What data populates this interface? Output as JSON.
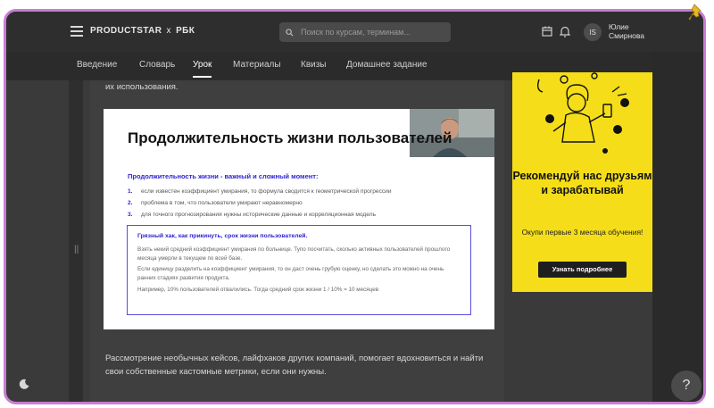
{
  "header": {
    "logo_text": "PRODUCTSTAR",
    "logo_x": "x",
    "logo_partner": "РБК",
    "search_placeholder": "Поиск по курсам, терминам...",
    "user_initials": "IS",
    "user_first": "Юлие",
    "user_last": "Смирнова"
  },
  "tabs": [
    "Введение",
    "Словарь",
    "Урок",
    "Материалы",
    "Квизы",
    "Домашнее задание"
  ],
  "active_tab": "Урок",
  "lesson": {
    "text_top": "их использования.",
    "text_bottom": "Рассмотрение необычных кейсов, лайфхаков других компаний, помогает вдохновиться и найти свои собственные кастомные метрики, если они нужны."
  },
  "slide": {
    "title": "Продолжительность жизни пользователей",
    "subheading": "Продолжительность жизни - важный и сложный момент:",
    "points": [
      {
        "n": "1.",
        "text": "если известен коэффициент умирания, то формула сводится к геометрической прогрессии"
      },
      {
        "n": "2.",
        "text": "проблема в том, что пользователи умирают неравномерно"
      },
      {
        "n": "3.",
        "text": "для точного прогнозирования нужны исторические данные и корреляционная модель"
      }
    ],
    "box_heading": "Грязный хак, как прикинуть, срок жизни пользователей.",
    "box_p1": "Взять некий средний коэффициент умирания по больнице. Тупо посчитать, сколько активных пользователей прошлого месяца умерли в текущем по всей базе.",
    "box_p2": "Если единицу разделить на коэффициент умирания, то он даст очень грубую оценку, но сделать это можно на очень ранних стадиях развития продукта.",
    "box_p3": "Например, 10% пользователей отвалились. Тогда средний срок жизни 1 / 10% = 10 месяцев"
  },
  "promo": {
    "title": "Рекомендуй нас друзьям и зарабатывай",
    "subtitle": "Окупи первые 3 месяца обучения!",
    "button": "Узнать подробнее"
  },
  "help_label": "?",
  "handle_label": "||",
  "colors": {
    "accent": "#2d1fd1",
    "promo_bg": "#f5de19",
    "frame_border": "#c77dd3"
  }
}
